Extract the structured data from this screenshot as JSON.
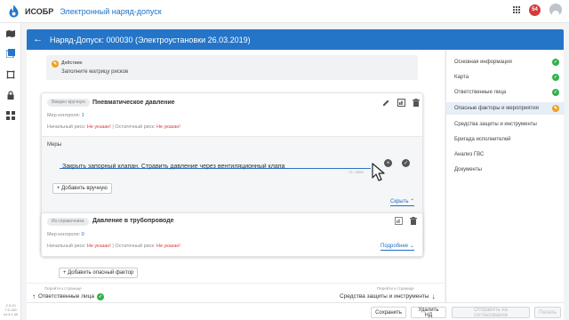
{
  "topbar": {
    "app_name": "ИСОБР",
    "app_subtitle": "Электронный наряд-допуск",
    "notifications_count": "54",
    "logo_icon": "flame-logo-icon",
    "apps_icon": "apps-grid-icon",
    "user_icon": "user-avatar-icon"
  },
  "leftnav": {
    "icons": [
      "map-icon",
      "documents-icon",
      "puzzle-icon",
      "lock-icon",
      "dashboard-icon"
    ],
    "version": [
      "2.3.10",
      "7.0.120",
      "v4.3.1.40"
    ]
  },
  "header": {
    "title": "Наряд-Допуск: 000030 (Электроустановки 26.03.2019)"
  },
  "action_box": {
    "label": "Действие",
    "text": "Заполните матрицу рисков"
  },
  "factor1": {
    "tag": "Введен вручную",
    "title": "Пневматическое давление",
    "controls_label": "Мер контроля:",
    "controls_count": "1",
    "initial_risk_label": "Начальный риск:",
    "initial_risk_value": "Не указан!",
    "residual_risk_label": "Остаточный риск:",
    "residual_risk_value": "Не указан!",
    "measures_label": "Меры",
    "measure_value": "Закрыть запорный клапан. Стравить давление через вентиляционный клапа",
    "char_count": "71 / 2000",
    "add_manual_label": "+ Добавить вручную",
    "collapse_label": "Скрыть"
  },
  "factor2": {
    "tag": "Из справочника",
    "title": "Давление в трубопроводе",
    "controls_label": "Мер контроля:",
    "controls_count": "0",
    "initial_risk_label": "Начальный риск:",
    "initial_risk_value": "Не указан!",
    "residual_risk_label": "Остаточный риск:",
    "residual_risk_value": "Не указан!",
    "more_label": "Подробнее"
  },
  "add_factor_label": "+ Добавить опасный фактор",
  "nav_prev": {
    "hint": "Перейти к странице",
    "target": "Ответственные лица"
  },
  "nav_next": {
    "hint": "Перейти к странице",
    "target": "Средства защиты и инструменты"
  },
  "sections": [
    {
      "label": "Основная информация",
      "status": "done"
    },
    {
      "label": "Карта",
      "status": "done"
    },
    {
      "label": "Ответственные лица",
      "status": "done"
    },
    {
      "label": "Опасные факторы и мероприятия",
      "status": "in-progress"
    },
    {
      "label": "Средства защиты и инструменты",
      "status": "none"
    },
    {
      "label": "Бригада исполнителей",
      "status": "none"
    },
    {
      "label": "Анализ ГВС",
      "status": "none"
    },
    {
      "label": "Документы",
      "status": "none"
    }
  ],
  "footer": {
    "save": "Сохранить",
    "delete": "Удалить НД",
    "send": "Отправить на согласование",
    "print": "Печать"
  },
  "colors": {
    "primary": "#2475c8",
    "success": "#2fb34a",
    "warning": "#f0a020",
    "danger": "#d63b3b"
  }
}
